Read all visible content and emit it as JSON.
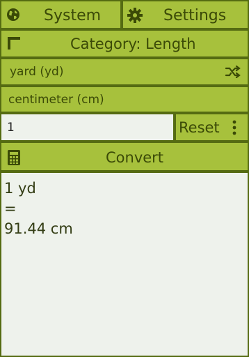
{
  "toolbar": {
    "system_label": "System",
    "settings_label": "Settings",
    "system_icon": "globe-icon",
    "settings_icon": "gear-icon"
  },
  "category": {
    "label": "Category: Length",
    "icon": "corner-bracket-icon"
  },
  "units": {
    "from": "yard (yd)",
    "to": "centimeter (cm)",
    "swap_icon": "shuffle-icon"
  },
  "input": {
    "value": "1"
  },
  "reset": {
    "label": "Reset",
    "menu_icon": "vertical-dots-icon"
  },
  "convert": {
    "label": "Convert",
    "icon": "calculator-icon"
  },
  "result": {
    "line1": "1 yd",
    "line2": "=",
    "line3": "91.44 cm"
  },
  "colors": {
    "accent": "#a7c13c",
    "frame": "#556b12",
    "text": "#3b4a07",
    "panel": "#eef2ec"
  }
}
